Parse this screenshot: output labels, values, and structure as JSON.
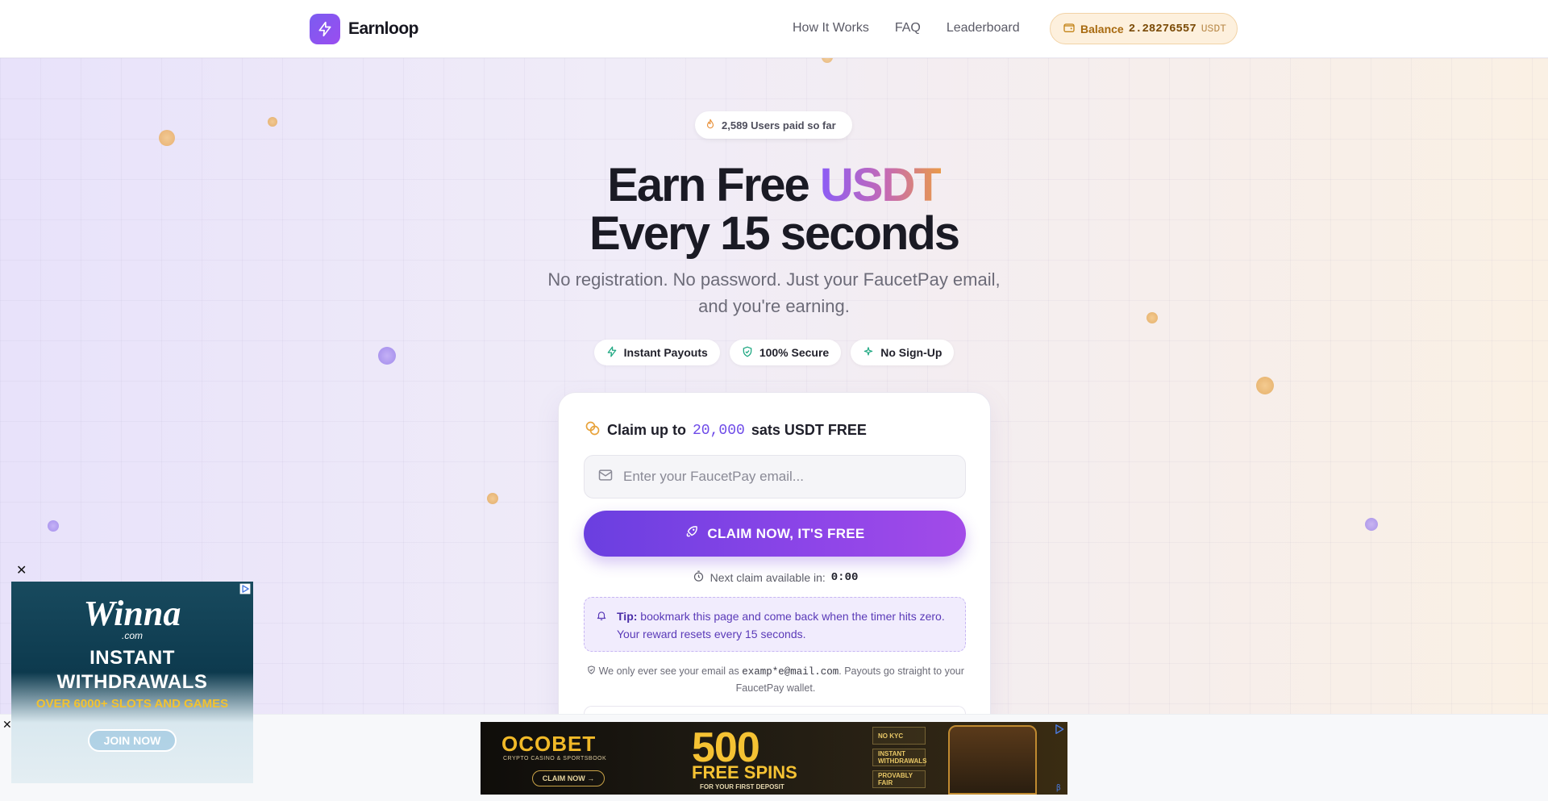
{
  "header": {
    "logo_text": "Earnloop",
    "nav": [
      "How It Works",
      "FAQ",
      "Leaderboard"
    ],
    "balance_label": "Balance",
    "balance_value": "2.28276557",
    "balance_unit": "USDT"
  },
  "hero": {
    "users_paid": "2,589 Users paid so far",
    "headline_part1": "Earn Free ",
    "headline_highlight": "USDT",
    "headline_line2": "Every 15 seconds",
    "subtitle": "No registration. No password. Just your FaucetPay email, and you're earning.",
    "features": [
      "Instant Payouts",
      "100% Secure",
      "No Sign-Up"
    ]
  },
  "card": {
    "title_prefix": "Claim up to",
    "title_amount": "20,000",
    "title_suffix": "sats USDT FREE",
    "email_placeholder": "Enter your FaucetPay email...",
    "claim_button": "CLAIM NOW, IT'S FREE",
    "next_claim_label": "Next claim available in:",
    "next_claim_timer": "0:00",
    "tip_label": "Tip:",
    "tip_text": "bookmark this page and come back when the timer hits zero. Your reward resets every 15 seconds.",
    "privacy_prefix": "We only ever see your email as",
    "privacy_email": "examp*e@mail.com",
    "privacy_suffix": ". Payouts go straight to your FaucetPay wallet."
  },
  "ads": {
    "side": {
      "brand": "Winna",
      "brand_sub": ".com",
      "headline_line1": "INSTANT",
      "headline_line2": "WITHDRAWALS",
      "tagline": "OVER 6000+ SLOTS AND GAMES",
      "cta": "JOIN NOW"
    },
    "banner": {
      "brand": "OCOBET",
      "brand_sub": "CRYPTO CASINO & SPORTSBOOK",
      "cta": "CLAIM NOW →",
      "big": "500",
      "spins": "FREE SPINS",
      "deposit": "FOR YOUR FIRST DEPOSIT",
      "features": [
        "NO KYC",
        "INSTANT WITHDRAWALS",
        "PROVABLY FAIR"
      ]
    }
  },
  "colors": {
    "accent": "#7c4dea",
    "balance_bg": "#fdf0dd",
    "feature_icon": "#1fa882"
  }
}
